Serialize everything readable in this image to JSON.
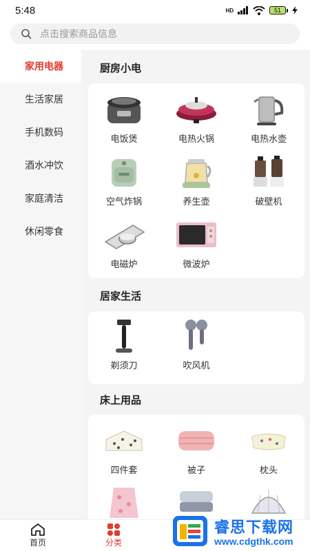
{
  "status": {
    "time": "5:48",
    "network": "HD",
    "battery": "51"
  },
  "search": {
    "placeholder": "点击搜索商品信息"
  },
  "sidebar": {
    "items": [
      {
        "label": "家用电器",
        "active": true
      },
      {
        "label": "生活家居"
      },
      {
        "label": "手机数码"
      },
      {
        "label": "酒水冲饮"
      },
      {
        "label": "家庭清洁"
      },
      {
        "label": "休闲零食"
      }
    ]
  },
  "sections": [
    {
      "title": "厨房小电",
      "items": [
        {
          "label": "电饭煲",
          "icon": "rice-cooker-icon"
        },
        {
          "label": "电热火锅",
          "icon": "hot-pot-icon"
        },
        {
          "label": "电热水壶",
          "icon": "kettle-icon"
        },
        {
          "label": "空气炸锅",
          "icon": "air-fryer-icon"
        },
        {
          "label": "养生壶",
          "icon": "health-pot-icon"
        },
        {
          "label": "破壁机",
          "icon": "blender-icon"
        },
        {
          "label": "电磁炉",
          "icon": "induction-cooker-icon"
        },
        {
          "label": "微波炉",
          "icon": "microwave-icon"
        }
      ]
    },
    {
      "title": "居家生活",
      "items": [
        {
          "label": "剃须刀",
          "icon": "razor-icon"
        },
        {
          "label": "吹风机",
          "icon": "hair-dryer-icon"
        }
      ]
    },
    {
      "title": "床上用品",
      "items": [
        {
          "label": "四件套",
          "icon": "bedding-set-icon"
        },
        {
          "label": "被子",
          "icon": "quilt-icon"
        },
        {
          "label": "枕头",
          "icon": "pillow-icon"
        },
        {
          "label": "",
          "icon": "blanket-icon"
        },
        {
          "label": "",
          "icon": "mattress-icon"
        },
        {
          "label": "",
          "icon": "mosquito-net-icon"
        }
      ]
    }
  ],
  "nav": {
    "tabs": [
      {
        "label": "首页",
        "icon": "home-icon"
      },
      {
        "label": "分类",
        "icon": "category-icon",
        "active": true
      }
    ]
  },
  "watermark": {
    "title": "睿思下载网",
    "url": "www.cdgthk.com"
  },
  "colors": {
    "accent": "#e23b2e",
    "watermark": "#1a73e8"
  }
}
